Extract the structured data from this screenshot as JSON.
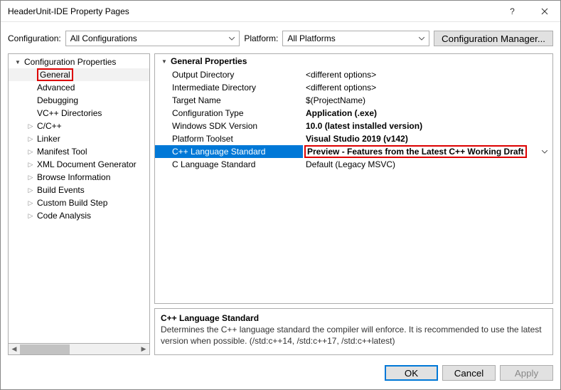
{
  "window": {
    "title": "HeaderUnit-IDE Property Pages"
  },
  "top": {
    "config_label": "Configuration:",
    "config_value": "All Configurations",
    "platform_label": "Platform:",
    "platform_value": "All Platforms",
    "config_mgr": "Configuration Manager..."
  },
  "tree": {
    "root": "Configuration Properties",
    "items": [
      {
        "label": "General",
        "selected": true,
        "highlight": true
      },
      {
        "label": "Advanced"
      },
      {
        "label": "Debugging"
      },
      {
        "label": "VC++ Directories"
      },
      {
        "label": "C/C++",
        "expandable": true
      },
      {
        "label": "Linker",
        "expandable": true
      },
      {
        "label": "Manifest Tool",
        "expandable": true
      },
      {
        "label": "XML Document Generator",
        "expandable": true
      },
      {
        "label": "Browse Information",
        "expandable": true
      },
      {
        "label": "Build Events",
        "expandable": true
      },
      {
        "label": "Custom Build Step",
        "expandable": true
      },
      {
        "label": "Code Analysis",
        "expandable": true
      }
    ]
  },
  "grid": {
    "header": "General Properties",
    "rows": [
      {
        "name": "Output Directory",
        "value": "<different options>"
      },
      {
        "name": "Intermediate Directory",
        "value": "<different options>"
      },
      {
        "name": "Target Name",
        "value": "$(ProjectName)"
      },
      {
        "name": "Configuration Type",
        "value": "Application (.exe)",
        "bold": true
      },
      {
        "name": "Windows SDK Version",
        "value": "10.0 (latest installed version)",
        "bold": true
      },
      {
        "name": "Platform Toolset",
        "value": "Visual Studio 2019 (v142)",
        "bold": true
      },
      {
        "name": "C++ Language Standard",
        "value": "Preview - Features from the Latest C++ Working Draft",
        "bold": true,
        "selected": true,
        "highlight_value": true,
        "dropdown": true
      },
      {
        "name": "C Language Standard",
        "value": "Default (Legacy MSVC)"
      }
    ]
  },
  "desc": {
    "title": "C++ Language Standard",
    "body": "Determines the C++ language standard the compiler will enforce. It is recommended to use the latest version when possible.   (/std:c++14, /std:c++17, /std:c++latest)"
  },
  "footer": {
    "ok": "OK",
    "cancel": "Cancel",
    "apply": "Apply"
  }
}
